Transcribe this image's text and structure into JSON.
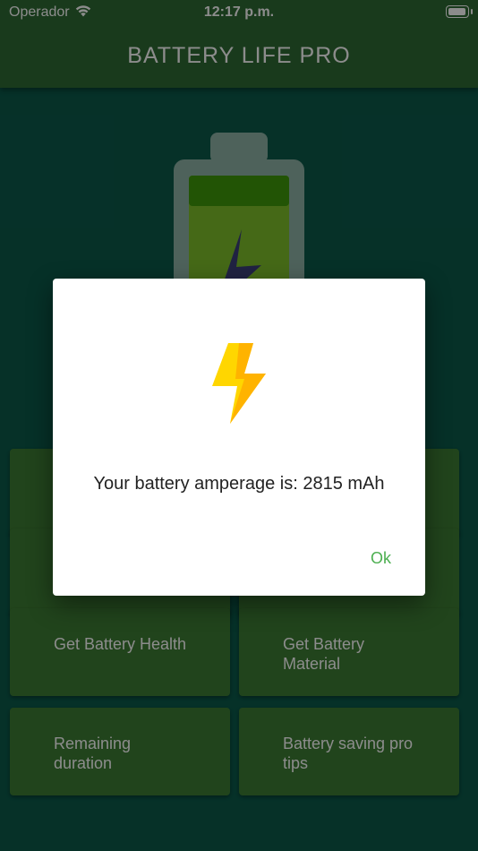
{
  "status_bar": {
    "carrier": "Operador",
    "time": "12:17 p.m."
  },
  "app_bar": {
    "title": "BATTERY LIFE PRO"
  },
  "menu": {
    "items": [
      {
        "label": "Get Battery Health"
      },
      {
        "label": "Get Battery Material"
      },
      {
        "label": "Remaining duration"
      },
      {
        "label": "Battery saving pro tips"
      }
    ]
  },
  "dialog": {
    "icon": "lightning-bolt-icon",
    "message": "Your battery amperage is: 2815 mAh",
    "ok_label": "Ok"
  },
  "colors": {
    "app_bar": "#2f6b33",
    "background": "#0b5a4a",
    "card": "#3d7d33",
    "ok_accent": "#4caf50",
    "bolt_yellow": "#ffd600"
  }
}
